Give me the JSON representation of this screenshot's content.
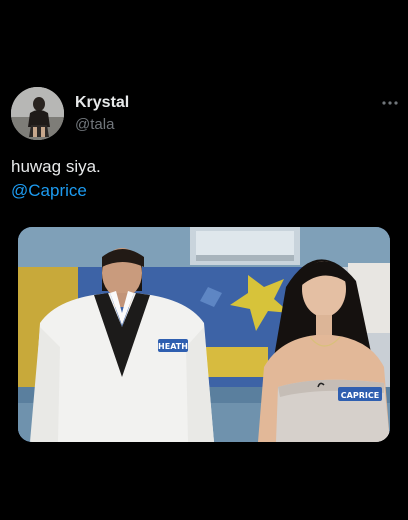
{
  "tweet": {
    "author": {
      "display_name": "Krystal",
      "handle": "@tala"
    },
    "text": "huwag siya.",
    "mention": "@Caprice",
    "more_icon": "more-horizontal-icon",
    "media": {
      "name_tags": {
        "left": "HEATH",
        "right": "CAPRICE"
      }
    }
  },
  "colors": {
    "background": "#000000",
    "primary_text": "#e7e9ea",
    "secondary_text": "#71767b",
    "link": "#1d9bf0"
  }
}
